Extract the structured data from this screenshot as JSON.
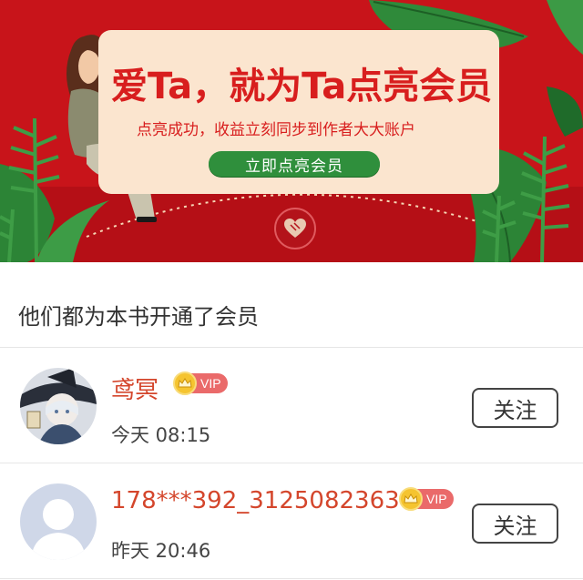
{
  "banner": {
    "headline": "爱Ta，就为Ta点亮会员",
    "subline": "点亮成功，收益立刻同步到作者大大账户",
    "cta_label": "立即点亮会员"
  },
  "section_title": "他们都为本书开通了会员",
  "members": [
    {
      "name": "鸢冥",
      "badge": "VIP",
      "time": "今天 08:15",
      "follow_label": "关注",
      "avatar": "anime-witch-avatar"
    },
    {
      "name": "178***392_3125082363",
      "badge": "VIP",
      "time": "昨天 20:46",
      "follow_label": "关注",
      "avatar": "default-person-avatar"
    }
  ],
  "colors": {
    "banner_red": "#c8141a",
    "letter_cream": "#fbe5cf",
    "cta_green": "#2f8f3c",
    "name_orange": "#d4462c",
    "vip_red": "#ea6a6a",
    "crown_gold": "#f5c430"
  }
}
